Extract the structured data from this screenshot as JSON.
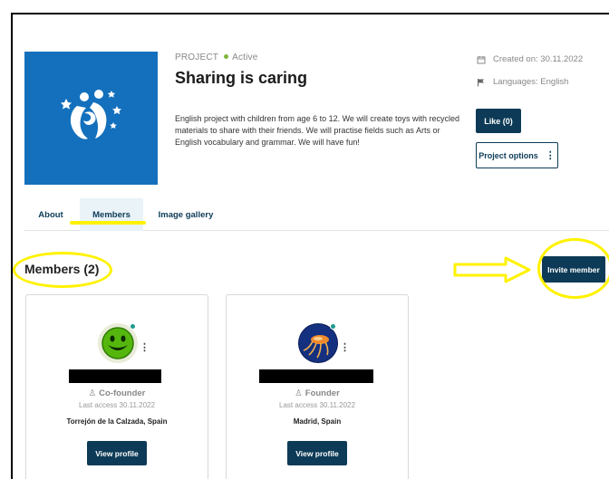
{
  "project": {
    "type_label": "PROJECT",
    "status": "Active",
    "title": "Sharing is caring",
    "description": "English project with children from age 6 to 12. We will create toys with recycled materials to share with their friends. We will practise fields such as Arts or English vocabulary and grammar. We will have fun!",
    "created": "Created on: 30.11.2022",
    "languages": "Languages: English",
    "like_label": "Like (0)",
    "options_label": "Project options",
    "image_color": "#1470bd"
  },
  "tabs": [
    {
      "label": "About"
    },
    {
      "label": "Members"
    },
    {
      "label": "Image gallery"
    }
  ],
  "members": {
    "title": "Members (2)",
    "invite_label": "Invite member",
    "cards": [
      {
        "role": "Co-founder",
        "last_access": "Last access 30.11.2022",
        "location": "Torrejón de la Calzada, Spain",
        "button": "View profile"
      },
      {
        "role": "Founder",
        "last_access": "Last access 30.11.2022",
        "location": "Madrid, Spain",
        "button": "View profile"
      }
    ]
  },
  "colors": {
    "primary": "#0d3b57",
    "highlight": "#fff200",
    "active_dot": "#7db73b",
    "online_dot": "#1e9a8c"
  }
}
